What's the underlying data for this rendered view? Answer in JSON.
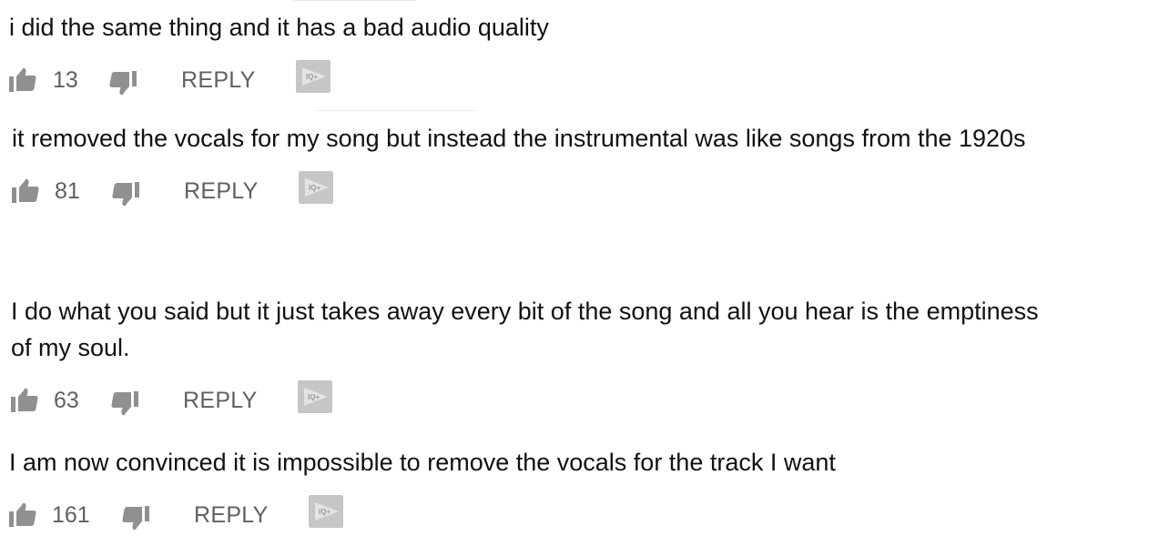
{
  "comments": [
    {
      "text": "i did the same thing and it has a bad audio quality",
      "likes": "13",
      "reply_label": "REPLY"
    },
    {
      "text": "it removed the vocals for my song but instead the instrumental was like songs from the 1920s",
      "likes": "81",
      "reply_label": "REPLY"
    },
    {
      "text": "I do what you said but it just takes away every bit of the song and all you hear is the emptiness\nof my soul.",
      "likes": "63",
      "reply_label": "REPLY"
    },
    {
      "text": "I am now convinced it is impossible to remove the vocals for the track I want",
      "likes": "161",
      "reply_label": "REPLY"
    }
  ],
  "icons": {
    "like": "thumb-up-icon",
    "dislike": "thumb-down-icon",
    "extension": "iq-extension-icon"
  },
  "colors": {
    "text": "#111111",
    "meta": "#606060",
    "icon": "#909090",
    "extension_bg": "#c6c6c6"
  }
}
